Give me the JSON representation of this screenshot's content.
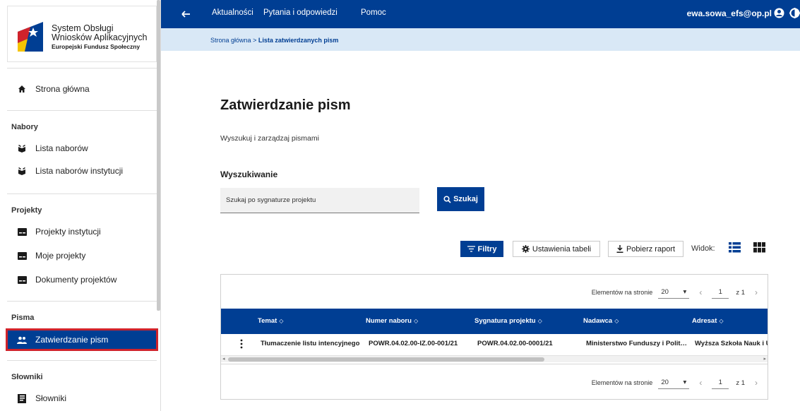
{
  "sidebar": {
    "logo": {
      "line1": "System Obsługi",
      "line2": "Wniosków Aplikacyjnych",
      "line3": "Europejski Fundusz Społeczny"
    },
    "home": "Strona główna",
    "sections": [
      {
        "title": "Nabory",
        "items": [
          "Lista naborów",
          "Lista naborów instytucji"
        ]
      },
      {
        "title": "Projekty",
        "items": [
          "Projekty instytucji",
          "Moje projekty",
          "Dokumenty projektów"
        ]
      },
      {
        "title": "Pisma",
        "items": [
          "Zatwierdzanie pism"
        ]
      },
      {
        "title": "Słowniki",
        "items": [
          "Słowniki"
        ]
      }
    ]
  },
  "topbar": {
    "nav": [
      "Aktualności",
      "Pytania i odpowiedzi",
      "Pomoc"
    ],
    "user_email": "ewa.sowa_efs@op.pl"
  },
  "breadcrumb": {
    "home": "Strona główna",
    "separator": ">",
    "current": "Lista zatwierdzanych pism"
  },
  "main": {
    "title": "Zatwierdzanie pism",
    "subtitle": "Wyszukuj i zarządzaj pismami",
    "search": {
      "label": "Wyszukiwanie",
      "placeholder": "Szukaj po sygnaturze projektu",
      "button": "Szukaj"
    },
    "toolbar": {
      "filters": "Filtry",
      "table_settings": "Ustawienia tabeli",
      "download_report": "Pobierz raport",
      "view_label": "Widok:"
    }
  },
  "table": {
    "pagination": {
      "per_page_label": "Elementów na stronie",
      "per_page_value": "20",
      "page": "1",
      "of_label": "z 1"
    },
    "columns": [
      "Temat",
      "Numer naboru",
      "Sygnatura projektu",
      "Nadawca",
      "Adresat"
    ],
    "rows": [
      [
        "Tłumaczenie listu intencyjnego",
        "POWR.04.02.00-IZ.00-001/21",
        "POWR.04.02.00-0001/21",
        "Ministerstwo Funduszy i Polit…",
        "Wyższa Szkoła Nauk i U"
      ]
    ]
  },
  "colors": {
    "primary": "#003e93",
    "breadcrumb_bg": "#d9e8f6",
    "highlight": "#d0232b"
  }
}
